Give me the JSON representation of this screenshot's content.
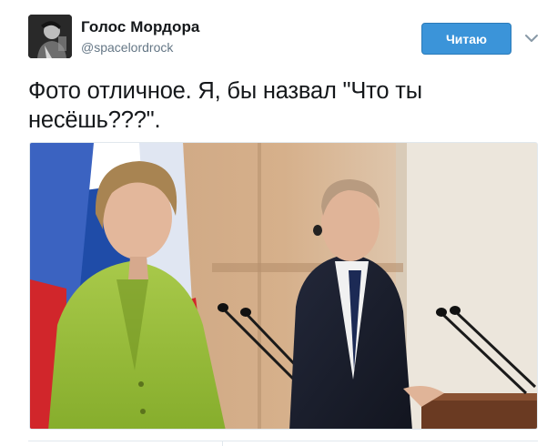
{
  "tweet": {
    "author_name": "Голос Мордора",
    "author_handle": "@spacelordrock",
    "follow_label": "Читаю",
    "text_line1": "Фото отличное. Я, бы назвал \"Что ты",
    "text_line2": "несёшь???\".",
    "avatar_icon": "user-avatar-photo",
    "menu_icon": "chevron-down-icon"
  },
  "colors": {
    "follow_button": "#3b94d9",
    "handle_text": "#657786",
    "text": "#14171a",
    "border": "#e1e8ed"
  }
}
